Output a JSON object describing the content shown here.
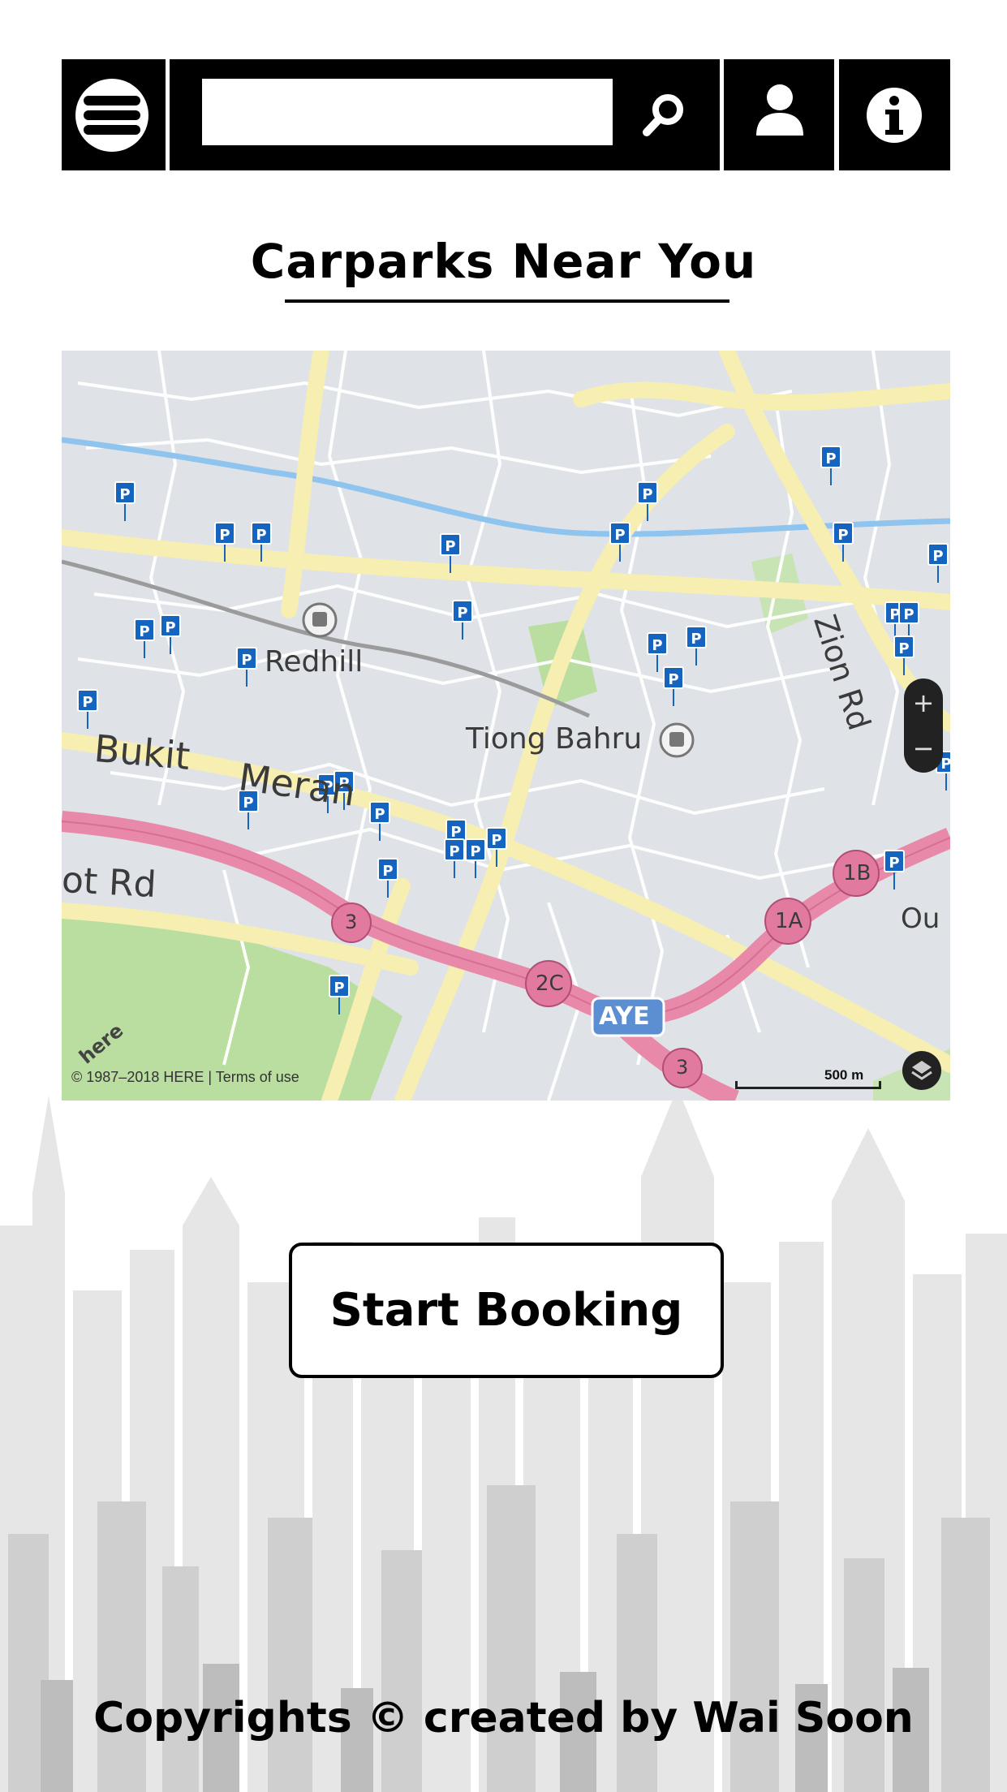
{
  "header": {
    "menu_icon": "hamburger-menu-icon",
    "search": {
      "value": "",
      "placeholder": ""
    },
    "search_icon": "search-icon",
    "user_icon": "user-icon",
    "info_icon": "info-icon"
  },
  "page_title": "Carparks Near You",
  "map": {
    "labels": {
      "redhill": "Redhill",
      "tiong_bahru": "Tiong Bahru",
      "bukit_merah_1": "Bukit",
      "bukit_merah_2": "Meran",
      "rd_partial": "ot  Rd",
      "zion_rd": "Zion Rd",
      "ou_partial": "Ou",
      "aye": "AYE",
      "exit_3a": "3",
      "exit_2c": "2C",
      "exit_1a": "1A",
      "exit_1b": "1B",
      "exit_3b": "3"
    },
    "parking_marker": "P",
    "zoom_in": "+",
    "zoom_out": "−",
    "attribution": "© 1987–2018 HERE | Terms of use",
    "scale": "500 m",
    "logo": "here",
    "colors": {
      "land": "#dfe3e7",
      "road_major": "#f7eeb1",
      "expressway": "#e889a9",
      "park": "#b9dea0",
      "river": "#8fc4ee",
      "marker": "#1565c0"
    }
  },
  "start_booking_label": "Start Booking",
  "footer_text": "Copyrights © created by Wai Soon"
}
